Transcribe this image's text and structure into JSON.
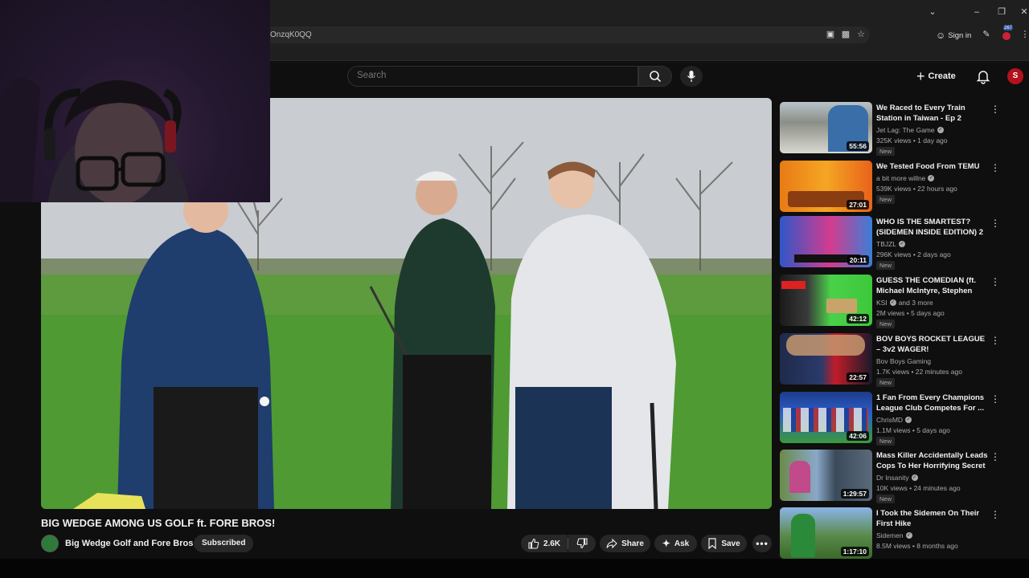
{
  "browser": {
    "url": "OnzqK0QQ",
    "signin_label": "Sign in",
    "extensions_badge": "267"
  },
  "header": {
    "search_placeholder": "Search",
    "create_label": "Create",
    "avatar_letter": "S"
  },
  "video": {
    "title": "BIG WEDGE AMONG US GOLF ft. FORE BROS!",
    "channel": "Big Wedge Golf and Fore Bros",
    "subscribe_label": "Subscribed",
    "like_count": "2.6K",
    "share_label": "Share",
    "ask_label": "Ask",
    "save_label": "Save"
  },
  "recommendations": [
    {
      "title": "We Raced to Every Train Station in Taiwan - Ep 2",
      "channel": "Jet Lag: The Game",
      "meta": "325K views • 1 day ago",
      "badge": "New",
      "duration": "55:56"
    },
    {
      "title": "We Tested Food From TEMU",
      "channel": "a bit more willne",
      "meta": "539K views • 22 hours ago",
      "badge": "New",
      "duration": "27:01"
    },
    {
      "title": "WHO IS THE SMARTEST? (SIDEMEN INSIDE EDITION) 2",
      "channel": "TBJZL",
      "meta": "296K views • 2 days ago",
      "badge": "New",
      "duration": "20:11"
    },
    {
      "title": "GUESS THE COMEDIAN (ft. Michael McIntyre, Stephen Tri...",
      "channel": "KSI",
      "channel_extra": "and 3 more",
      "meta": "2M views • 5 days ago",
      "badge": "New",
      "duration": "42:12"
    },
    {
      "title": "BOV BOYS ROCKET LEAGUE – 3v2 WAGER!",
      "channel": "Bov Boys Gaming",
      "meta": "1.7K views • 22 minutes ago",
      "badge": "New",
      "duration": "22:57"
    },
    {
      "title": "1 Fan From Every Champions League Club Competes For ...",
      "channel": "ChrisMD",
      "meta": "1.1M views • 5 days ago",
      "badge": "New",
      "duration": "42:06"
    },
    {
      "title": "Mass Killer Accidentally Leads Cops To Her Horrifying Secret",
      "channel": "Dr Insanity",
      "meta": "10K views • 24 minutes ago",
      "badge": "New",
      "duration": "1:29:57"
    },
    {
      "title": "I Took the Sidemen On Their First Hike",
      "channel": "Sidemen",
      "meta": "8.5M views • 8 months ago",
      "badge": "",
      "duration": "1:17:10"
    }
  ]
}
